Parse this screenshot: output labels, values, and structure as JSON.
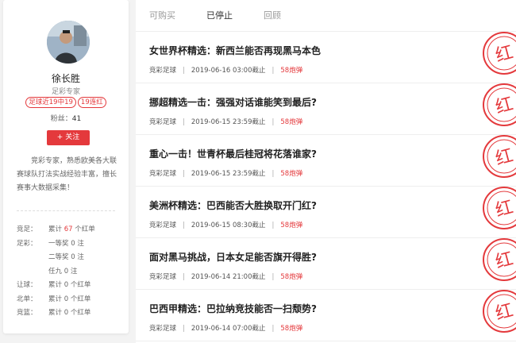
{
  "profile": {
    "name": "徐长胜",
    "title": "足彩专家",
    "badges": [
      "足球近19中19",
      "19连红"
    ],
    "fans_label": "粉丝：",
    "fans_count": "41",
    "follow_label": "+ 关注",
    "bio": "竞彩专家，熟悉欧美各大联赛球队打法实战经验丰富，擅长赛事大数据采集！",
    "stats": [
      {
        "label": "竞足：",
        "pre": "累计 ",
        "value": "67",
        "post": " 个红单",
        "highlight": true
      },
      {
        "label": "足彩：",
        "pre": "一等奖 ",
        "value": "0",
        "post": " 注",
        "highlight": false
      },
      {
        "label": "",
        "pre": "二等奖 ",
        "value": "0",
        "post": " 注",
        "highlight": false
      },
      {
        "label": "",
        "pre": "任九 ",
        "value": "0",
        "post": " 注",
        "highlight": false
      },
      {
        "label": "让球：",
        "pre": "累计 ",
        "value": "0",
        "post": " 个红单",
        "highlight": false
      },
      {
        "label": "北单：",
        "pre": "累计 ",
        "value": "0",
        "post": " 个红单",
        "highlight": false
      },
      {
        "label": "竞篮：",
        "pre": "累计 ",
        "value": "0",
        "post": " 个红单",
        "highlight": false
      }
    ]
  },
  "tabs": [
    {
      "label": "可购买",
      "active": false
    },
    {
      "label": "已停止",
      "active": true
    },
    {
      "label": "回顾",
      "active": false
    }
  ],
  "articles": [
    {
      "title": "女世界杯精选：新西兰能否再现黑马本色",
      "category": "竞彩足球",
      "deadline": "2019-06-16 03:00截止",
      "price": "58炮弹"
    },
    {
      "title": "挪超精选一击：强强对话谁能笑到最后?",
      "category": "竞彩足球",
      "deadline": "2019-06-15 23:59截止",
      "price": "58炮弹"
    },
    {
      "title": "重心一击！世青杯最后桂冠将花落谁家?",
      "category": "竞彩足球",
      "deadline": "2019-06-15 23:59截止",
      "price": "58炮弹"
    },
    {
      "title": "美洲杯精选：巴西能否大胜换取开门红?",
      "category": "竞彩足球",
      "deadline": "2019-06-15 08:30截止",
      "price": "58炮弹"
    },
    {
      "title": "面对黑马挑战，日本女足能否旗开得胜?",
      "category": "竞彩足球",
      "deadline": "2019-06-14 21:00截止",
      "price": "58炮弹"
    },
    {
      "title": "巴西甲精选：巴拉纳竞技能否一扫颓势?",
      "category": "竞彩足球",
      "deadline": "2019-06-14 07:00截止",
      "price": "58炮弹"
    }
  ],
  "stamp_text": "红",
  "colors": {
    "accent": "#e4393c",
    "stamp": "#e4393c"
  }
}
